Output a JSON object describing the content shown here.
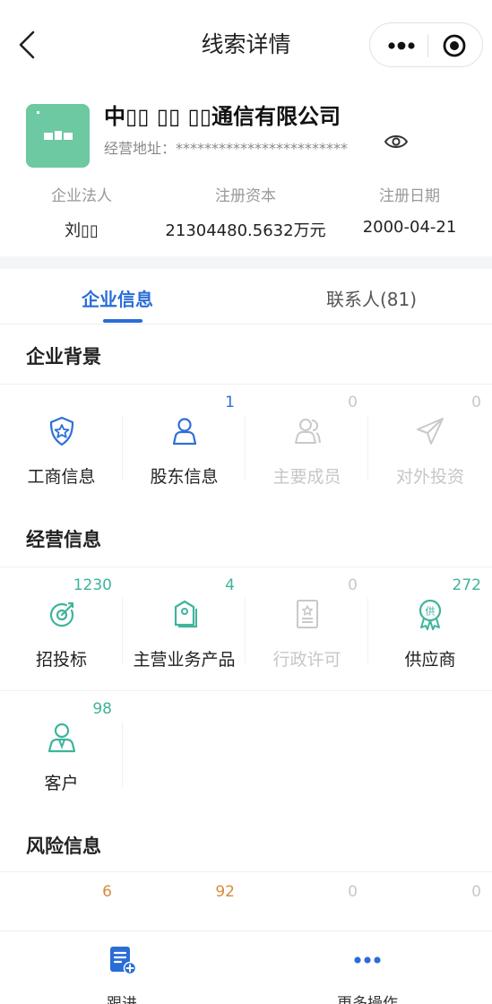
{
  "header": {
    "title": "线索详情",
    "back_icon": "chevron-left-icon",
    "more_icon": "more-dots-icon",
    "target_icon": "target-circle-icon"
  },
  "company": {
    "name": "中▯▯ ▯▯ ▯▯通信有限公司",
    "address_label": "经营地址：",
    "address_value": "************************",
    "stats": [
      {
        "label": "企业法人",
        "value": "刘▯▯"
      },
      {
        "label": "注册资本",
        "value": "21304480.5632万元"
      },
      {
        "label": "注册日期",
        "value": "2000-04-21"
      }
    ]
  },
  "tabs": [
    {
      "label": "企业信息",
      "active": true
    },
    {
      "label": "联系人(81)",
      "active": false
    }
  ],
  "sections": {
    "background": {
      "title": "企业背景",
      "items": [
        {
          "label": "工商信息",
          "count": "",
          "icon": "police-badge-icon",
          "enabled": true
        },
        {
          "label": "股东信息",
          "count": "1",
          "icon": "person-icon",
          "enabled": true
        },
        {
          "label": "主要成员",
          "count": "0",
          "icon": "group-icon",
          "enabled": false
        },
        {
          "label": "对外投资",
          "count": "0",
          "icon": "paper-plane-icon",
          "enabled": false
        }
      ]
    },
    "operation": {
      "title": "经营信息",
      "items": [
        {
          "label": "招投标",
          "count": "1230",
          "icon": "bid-target-icon",
          "enabled": true
        },
        {
          "label": "主营业务产品",
          "count": "4",
          "icon": "product-tag-icon",
          "enabled": true
        },
        {
          "label": "行政许可",
          "count": "0",
          "icon": "license-certificate-icon",
          "enabled": false
        },
        {
          "label": "供应商",
          "count": "272",
          "icon": "supplier-medal-icon",
          "enabled": true
        },
        {
          "label": "客户",
          "count": "98",
          "icon": "customer-person-icon",
          "enabled": true
        }
      ]
    },
    "risk": {
      "title": "风险信息",
      "counts": [
        "6",
        "92",
        "0",
        "0"
      ]
    }
  },
  "bottom_bar": [
    {
      "label": "跟进",
      "icon": "follow-up-note-icon"
    },
    {
      "label": "更多操作",
      "icon": "more-dots-icon"
    }
  ],
  "colors": {
    "primary": "#2a6dd6",
    "teal": "#3fb49b",
    "orange": "#d88a3c",
    "disabled": "#c7c7c7",
    "logo_bg": "#6cc9a1"
  }
}
